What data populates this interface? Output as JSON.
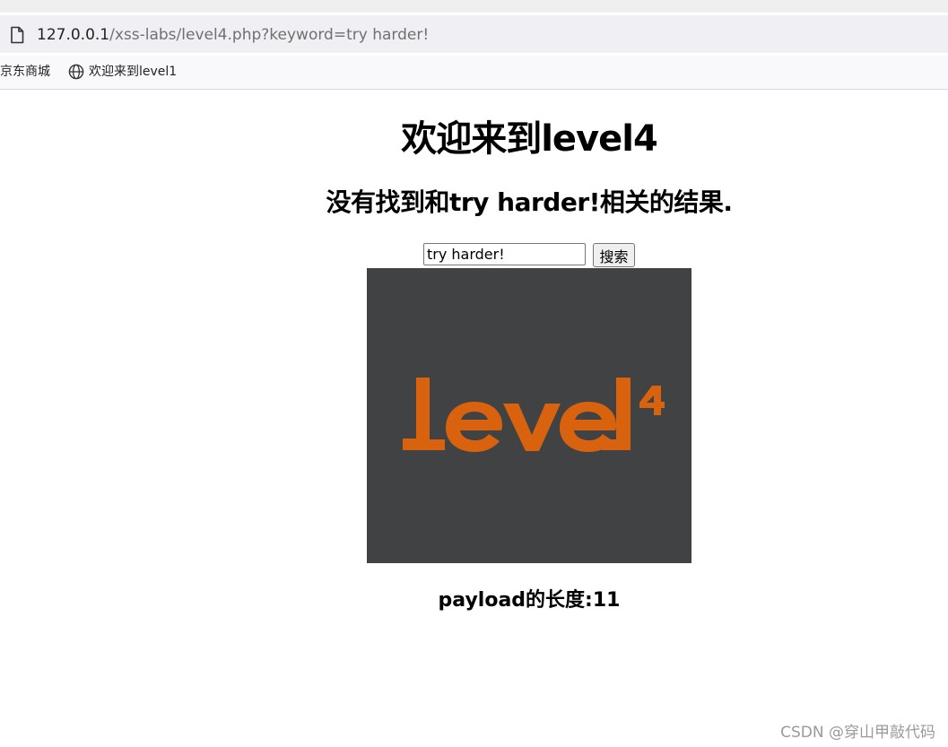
{
  "browser": {
    "url_host": "127.0.0.1",
    "url_path": "/xss-labs/level4.php?keyword=try harder!",
    "bookmarks": [
      {
        "label": "京东商城",
        "icon": "none"
      },
      {
        "label": "欢迎来到level1",
        "icon": "globe-icon"
      }
    ]
  },
  "page": {
    "title": "欢迎来到level4",
    "result_message": "没有找到和try harder!相关的结果.",
    "search": {
      "value": "try harder!",
      "button_label": "搜索"
    },
    "logo": {
      "text": "level",
      "superscript": "4",
      "colors": {
        "background": "#414244",
        "text": "#d9620f"
      }
    },
    "payload_length": "payload的长度:11"
  },
  "watermark": "CSDN @穿山甲敲代码"
}
